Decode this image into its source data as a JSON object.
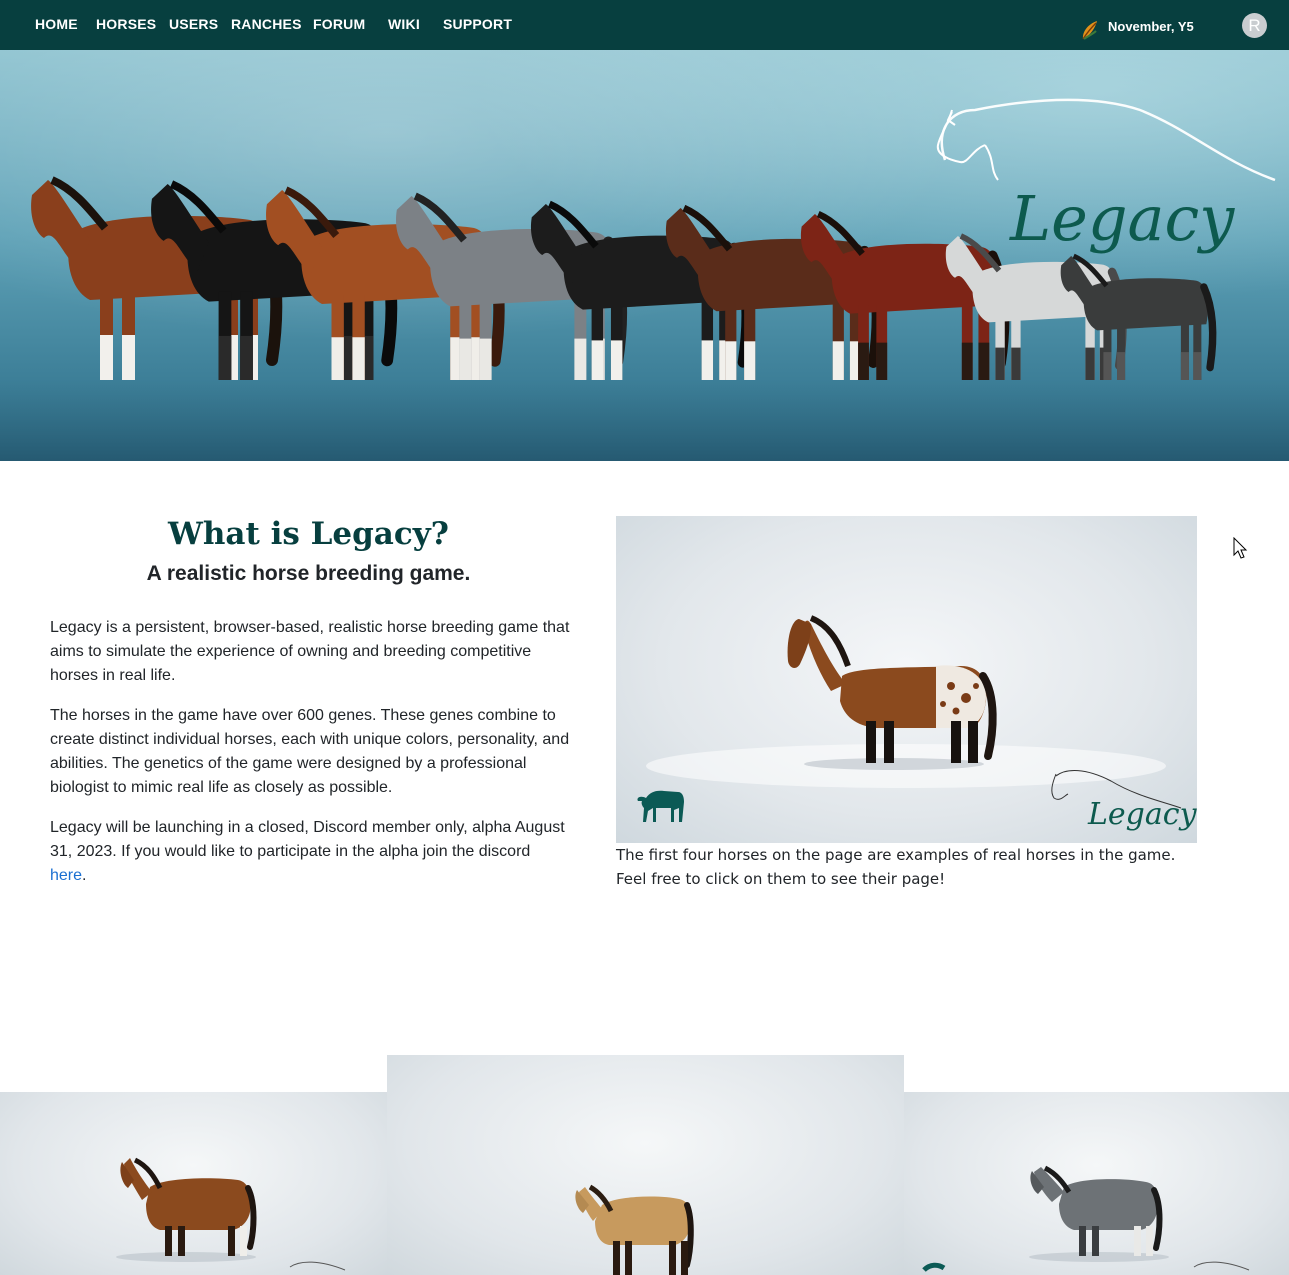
{
  "nav": {
    "links": [
      "HOME",
      "HORSES",
      "USERS",
      "RANCHES",
      "FORUM",
      "WIKI",
      "SUPPORT"
    ],
    "date": "November, Y5",
    "avatar_initial": "R",
    "season_icon": "autumn-leaf-icon"
  },
  "banner": {
    "logo_text": "Legacy"
  },
  "intro": {
    "title": "What is Legacy?",
    "subtitle": "A realistic horse breeding game.",
    "paragraphs": [
      "Legacy is a persistent, browser-based, realistic horse breeding game that aims to simulate the experience of owning and breeding competitive horses in real life.",
      "The horses in the game have over 600 genes. These genes combine to create distinct individual horses, each with unique colors, personality, and abilities. The genetics of the game were designed by a professional biologist to mimic real life as closely as possible."
    ],
    "launch_text": "Legacy will be launching in a closed, Discord member only, alpha August 31, 2023. If you would like to participate in the alpha join the discord ",
    "launch_link": "here",
    "launch_end": "."
  },
  "showcase": {
    "watermark_text": "Legacy",
    "caption": "The first four horses on the page are examples of real horses in the game. Feel free to click on them to see their page!"
  },
  "colors": {
    "nav_bg": "#073f3f",
    "title": "#073f3f",
    "link": "#1a6fd1"
  }
}
